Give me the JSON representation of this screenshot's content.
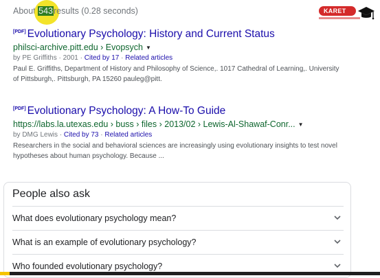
{
  "stats": {
    "prefix": "About ",
    "count": "543",
    "suffix": "results (0.28 seconds)"
  },
  "logo": {
    "text": "KARET"
  },
  "results": [
    {
      "pdf_tag": "[PDF]",
      "title": "Evolutionary Psychology: History and Current Status",
      "url": "philsci-archive.pitt.edu › Evopsych",
      "meta_prefix": "by PE Griffiths · 2001 · ",
      "cited": "Cited by 17",
      "sep": " · ",
      "related": "Related articles",
      "snippet": "Paul E. Griffiths, Department of History and Philosophy of Science,. 1017 Cathedral of Learning,. University of Pittsburgh,. Pittsburgh, PA 15260 pauleg@pitt."
    },
    {
      "pdf_tag": "[PDF]",
      "title": "Evolutionary Psychology: A How-To Guide",
      "url": "https://labs.la.utexas.edu › buss › files › 2013/02 › Lewis-Al-Shawaf-Conr...",
      "meta_prefix": "by DMG Lewis · ",
      "cited": "Cited by 73",
      "sep": " · ",
      "related": "Related articles",
      "snippet": "Researchers in the social and behavioral sciences are increasingly using evolutionary insights to test novel hypotheses about human psychology. Because ..."
    }
  ],
  "paa": {
    "title": "People also ask",
    "questions": [
      "What does evolutionary psychology mean?",
      "What is an example of evolutionary psychology?",
      "Who founded evolutionary psychology?"
    ]
  }
}
